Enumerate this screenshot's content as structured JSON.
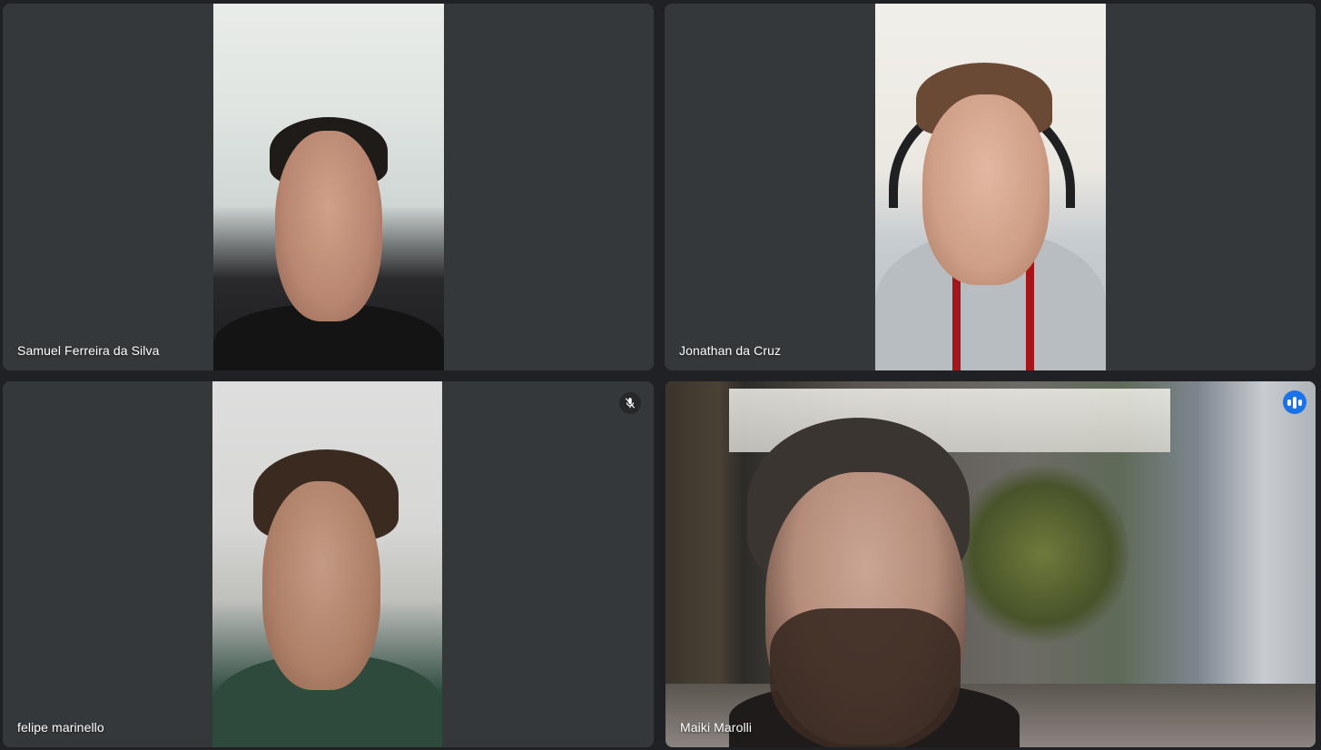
{
  "participants": [
    {
      "name": "Samuel Ferreira da Silva",
      "muted": false,
      "speaking": false
    },
    {
      "name": "Jonathan da Cruz",
      "muted": false,
      "speaking": false
    },
    {
      "name": "felipe marinello",
      "muted": true,
      "speaking": false
    },
    {
      "name": "Maiki Marolli",
      "muted": false,
      "speaking": true
    }
  ],
  "icons": {
    "muted": "mic-off-icon",
    "speaking": "audio-level-icon"
  },
  "colors": {
    "tile_background": "#35383b",
    "page_background": "#202124",
    "active_speaker_border": "#8ab4f8",
    "speaking_indicator": "#1a73e8"
  }
}
